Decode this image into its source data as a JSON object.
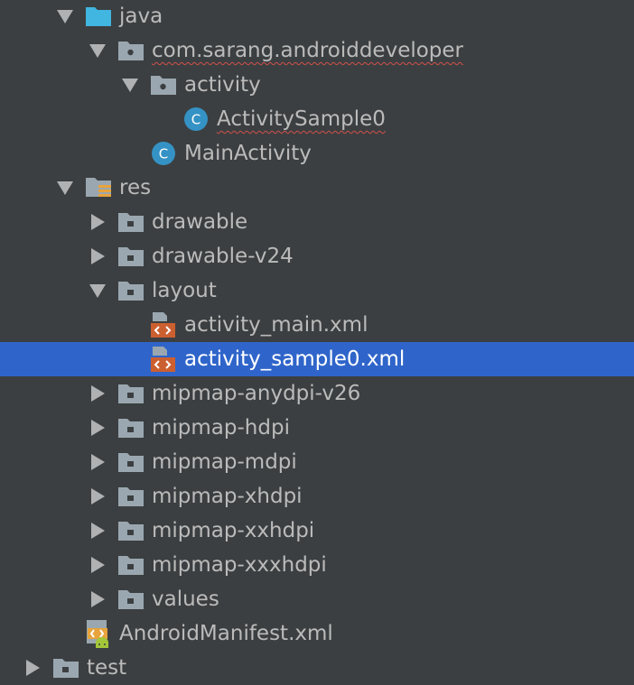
{
  "project_tree": {
    "items": [
      {
        "label": "java",
        "icon": "source-folder-icon",
        "expander": "expanded"
      },
      {
        "label": "com.sarang.androiddeveloper",
        "icon": "package-folder-icon",
        "expander": "expanded",
        "spell_error": true
      },
      {
        "label": "activity",
        "icon": "package-folder-icon",
        "expander": "expanded"
      },
      {
        "label": "ActivitySample0",
        "icon": "class-icon",
        "expander": "none",
        "spell_error": true
      },
      {
        "label": "MainActivity",
        "icon": "class-icon",
        "expander": "none"
      },
      {
        "label": "res",
        "icon": "resources-folder-icon",
        "expander": "expanded"
      },
      {
        "label": "drawable",
        "icon": "folder-icon",
        "expander": "collapsed"
      },
      {
        "label": "drawable-v24",
        "icon": "folder-icon",
        "expander": "collapsed"
      },
      {
        "label": "layout",
        "icon": "folder-icon",
        "expander": "expanded"
      },
      {
        "label": "activity_main.xml",
        "icon": "layout-xml-icon",
        "expander": "none"
      },
      {
        "label": "activity_sample0.xml",
        "icon": "layout-xml-icon",
        "expander": "none",
        "selected": true
      },
      {
        "label": "mipmap-anydpi-v26",
        "icon": "folder-icon",
        "expander": "collapsed"
      },
      {
        "label": "mipmap-hdpi",
        "icon": "folder-icon",
        "expander": "collapsed"
      },
      {
        "label": "mipmap-mdpi",
        "icon": "folder-icon",
        "expander": "collapsed"
      },
      {
        "label": "mipmap-xhdpi",
        "icon": "folder-icon",
        "expander": "collapsed"
      },
      {
        "label": "mipmap-xxhdpi",
        "icon": "folder-icon",
        "expander": "collapsed"
      },
      {
        "label": "mipmap-xxxhdpi",
        "icon": "folder-icon",
        "expander": "collapsed"
      },
      {
        "label": "values",
        "icon": "folder-icon",
        "expander": "collapsed"
      },
      {
        "label": "AndroidManifest.xml",
        "icon": "android-manifest-icon",
        "expander": "none"
      },
      {
        "label": "test",
        "icon": "folder-icon",
        "expander": "collapsed"
      }
    ]
  },
  "colors": {
    "background": "#3c3f41",
    "selection": "#2f65ca",
    "text": "#bbbbbb",
    "folder": "#9aa7b0",
    "source_folder": "#40b6e0",
    "class_icon": "#3592c4",
    "xml_icon": "#cc5f30",
    "android_green": "#a4c639",
    "spell_underline": "#d2504b"
  }
}
